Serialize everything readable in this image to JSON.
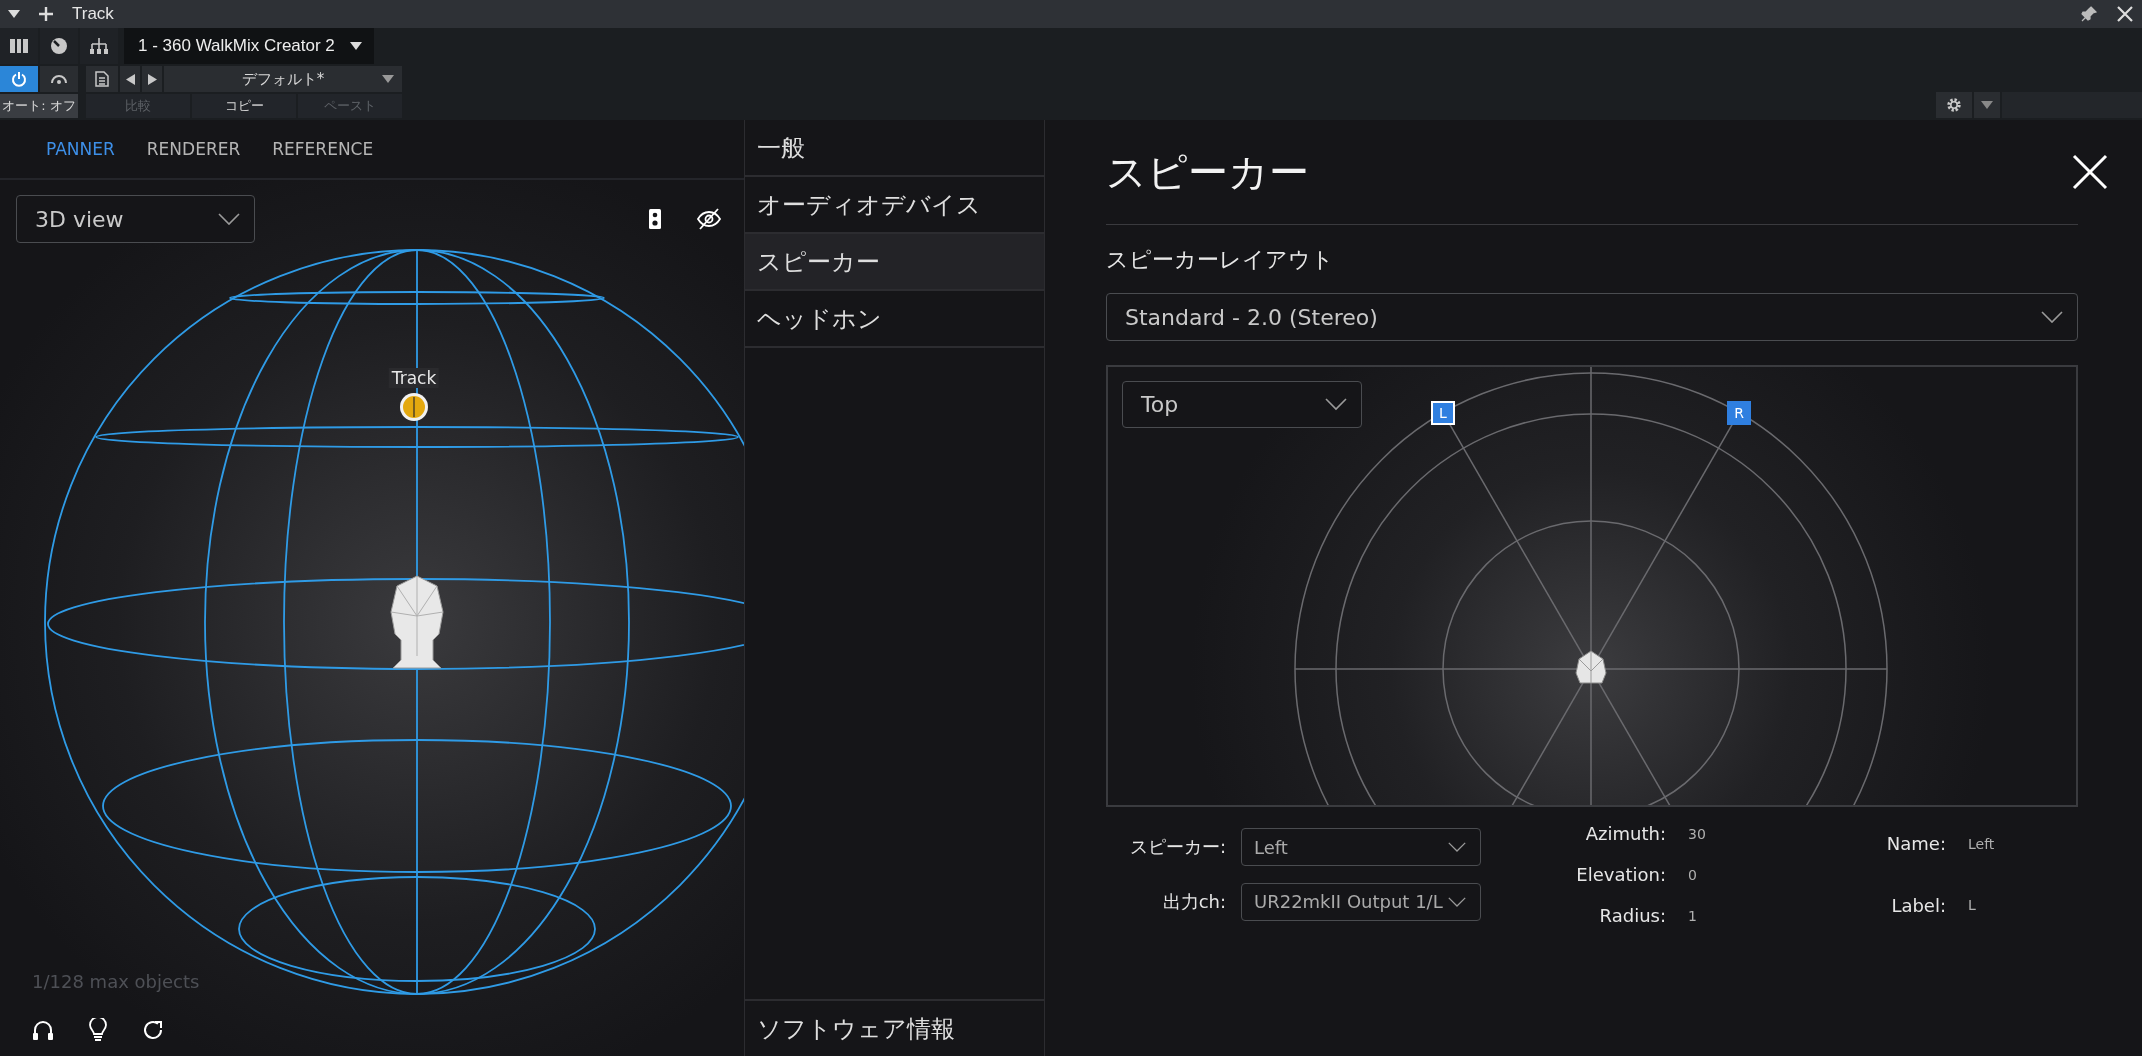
{
  "window": {
    "title": "Track"
  },
  "toolbar": {
    "device": "1 - 360 WalkMix Creator 2",
    "power": {
      "on": true
    },
    "auto_label": "オート: オフ",
    "preset": "デフォルト*",
    "actions": [
      {
        "label": "比較",
        "disabled": true
      },
      {
        "label": "コピー",
        "disabled": false
      },
      {
        "label": "ペースト",
        "disabled": true
      }
    ]
  },
  "panner": {
    "tabs": [
      {
        "label": "PANNER",
        "selected": true
      },
      {
        "label": "RENDERER",
        "selected": false
      },
      {
        "label": "REFERENCE",
        "selected": false
      }
    ],
    "view_select": "3D view",
    "object_label": "Track",
    "status": "1/128 max objects"
  },
  "settings_menu": {
    "items": [
      {
        "label": "一般",
        "selected": false
      },
      {
        "label": "オーディオデバイス",
        "selected": false
      },
      {
        "label": "スピーカー",
        "selected": true
      },
      {
        "label": "ヘッドホン",
        "selected": false
      }
    ],
    "footer_item": "ソフトウェア情報"
  },
  "speaker_page": {
    "title": "スピーカー",
    "layout_label": "スピーカーレイアウト",
    "layout_value": "Standard - 2.0 (Stereo)",
    "view_select": "Top",
    "speakers": [
      {
        "label": "L",
        "selected": true
      },
      {
        "label": "R",
        "selected": false
      }
    ],
    "selects": [
      {
        "label": "スピーカー:",
        "value": "Left"
      },
      {
        "label": "出力ch:",
        "value": "UR22mkII Output 1/L"
      }
    ],
    "position": [
      {
        "label": "Azimuth:",
        "value": "30"
      },
      {
        "label": "Elevation:",
        "value": "0"
      },
      {
        "label": "Radius:",
        "value": "1"
      }
    ],
    "identity": [
      {
        "label": "Name:",
        "value": "Left"
      },
      {
        "label": "Label:",
        "value": "L"
      }
    ]
  }
}
